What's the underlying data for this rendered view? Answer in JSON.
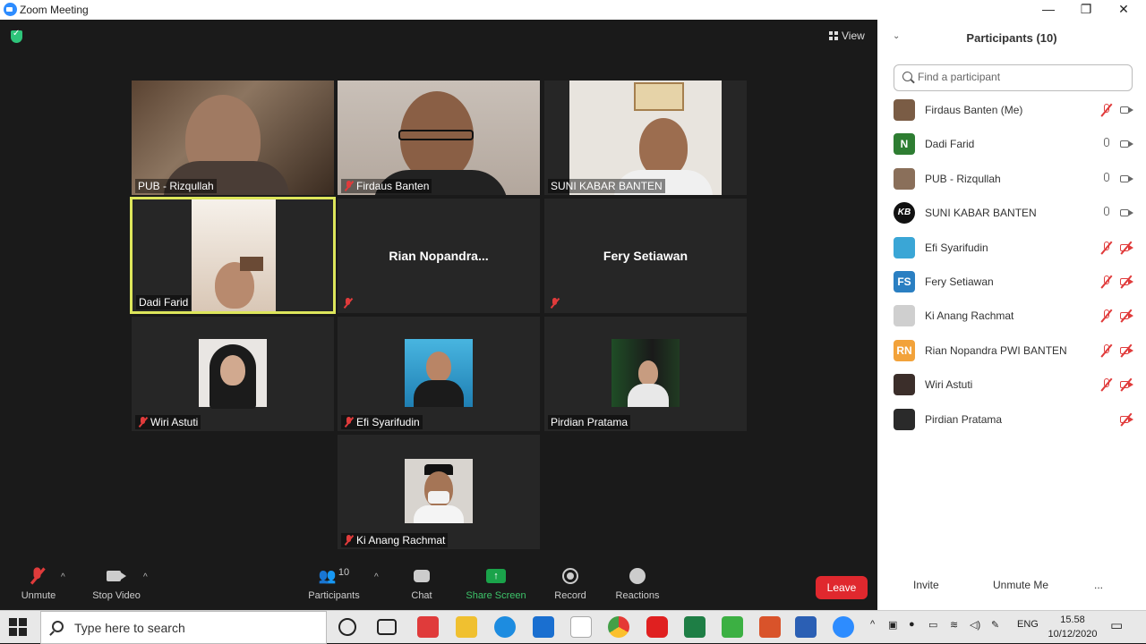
{
  "window": {
    "title": "Zoom Meeting",
    "minimize": "—",
    "restore": "❐",
    "close": "✕"
  },
  "view_label": "View",
  "tiles": [
    {
      "name": "PUB - Rizqullah",
      "muted": false
    },
    {
      "name": "Firdaus Banten",
      "muted": true
    },
    {
      "name": "SUNI KABAR BANTEN",
      "muted": false
    },
    {
      "name": "Dadi Farid",
      "muted": false,
      "active": true
    },
    {
      "name": "Rian  Nopandra...",
      "muted": true,
      "no_video": true
    },
    {
      "name": "Fery Setiawan",
      "muted": true,
      "no_video": true
    },
    {
      "name": "Wiri Astuti",
      "muted": true
    },
    {
      "name": "Efi Syarifudin",
      "muted": true
    },
    {
      "name": "Pirdian Pratama",
      "muted": false
    },
    {
      "name": "Ki Anang Rachmat",
      "muted": true
    }
  ],
  "controls": {
    "unmute": "Unmute",
    "stop_video": "Stop Video",
    "participants": "Participants",
    "participants_count": "10",
    "chat": "Chat",
    "share_screen": "Share Screen",
    "record": "Record",
    "reactions": "Reactions",
    "leave": "Leave"
  },
  "panel": {
    "title": "Participants (10)",
    "search_placeholder": "Find a participant",
    "participants": [
      {
        "name": "Firdaus Banten (Me)",
        "initials": "",
        "color": "#7a5c45",
        "mic": "off",
        "cam": "on"
      },
      {
        "name": "Dadi Farid",
        "initials": "N",
        "color": "#2e7d32",
        "mic": "on",
        "cam": "on"
      },
      {
        "name": "PUB - Rizqullah",
        "initials": "",
        "color": "#8a6f5a",
        "mic": "on",
        "cam": "on"
      },
      {
        "name": "SUNI KABAR BANTEN",
        "initials": "KB",
        "color": "#111111",
        "mic": "on",
        "cam": "on"
      },
      {
        "name": "Efi Syarifudin",
        "initials": "",
        "color": "#3aa6d6",
        "mic": "off",
        "cam": "off"
      },
      {
        "name": "Fery Setiawan",
        "initials": "FS",
        "color": "#2a7fc2",
        "mic": "off",
        "cam": "off"
      },
      {
        "name": "Ki Anang Rachmat",
        "initials": "",
        "color": "#cfcfcf",
        "mic": "off",
        "cam": "off"
      },
      {
        "name": "Rian Nopandra PWI BANTEN",
        "initials": "RN",
        "color": "#f2a23a",
        "mic": "off",
        "cam": "off"
      },
      {
        "name": "Wiri Astuti",
        "initials": "",
        "color": "#3b2e2a",
        "mic": "off",
        "cam": "off"
      },
      {
        "name": "Pirdian Pratama",
        "initials": "",
        "color": "#2a2a2a",
        "mic": "",
        "cam": "off"
      }
    ],
    "invite": "Invite",
    "unmute_me": "Unmute Me",
    "more": "..."
  },
  "taskbar": {
    "search_placeholder": "Type here to search",
    "lang": "ENG",
    "time": "15.58",
    "date": "10/12/2020"
  }
}
